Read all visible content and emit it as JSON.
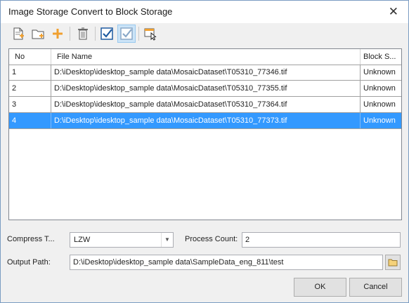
{
  "window": {
    "title": "Image Storage Convert to Block Storage"
  },
  "toolbar": {
    "icons": [
      "add-file-icon",
      "add-folder-icon",
      "add-icon",
      "delete-icon",
      "select-all-icon",
      "select-inverse-icon",
      "select-cursor-icon"
    ]
  },
  "table": {
    "columns": [
      "No",
      "File Name",
      "Block S..."
    ],
    "rows": [
      {
        "no": "1",
        "file": "D:\\iDesktop\\idesktop_sample data\\MosaicDataset\\T05310_77346.tif",
        "status": "Unknown"
      },
      {
        "no": "2",
        "file": "D:\\iDesktop\\idesktop_sample data\\MosaicDataset\\T05310_77355.tif",
        "status": "Unknown"
      },
      {
        "no": "3",
        "file": "D:\\iDesktop\\idesktop_sample data\\MosaicDataset\\T05310_77364.tif",
        "status": "Unknown"
      },
      {
        "no": "4",
        "file": "D:\\iDesktop\\idesktop_sample data\\MosaicDataset\\T05310_77373.tif",
        "status": "Unknown"
      }
    ],
    "selected_row": 4
  },
  "form": {
    "compress_label": "Compress T...",
    "compress_value": "LZW",
    "process_label": "Process Count:",
    "process_value": "2",
    "output_label": "Output Path:",
    "output_value": "D:\\iDesktop\\idesktop_sample data\\SampleData_eng_811\\test"
  },
  "buttons": {
    "ok": "OK",
    "cancel": "Cancel"
  },
  "colors": {
    "selection": "#3399ff",
    "accent": "#1e6fc8",
    "orange": "#f0a030"
  }
}
